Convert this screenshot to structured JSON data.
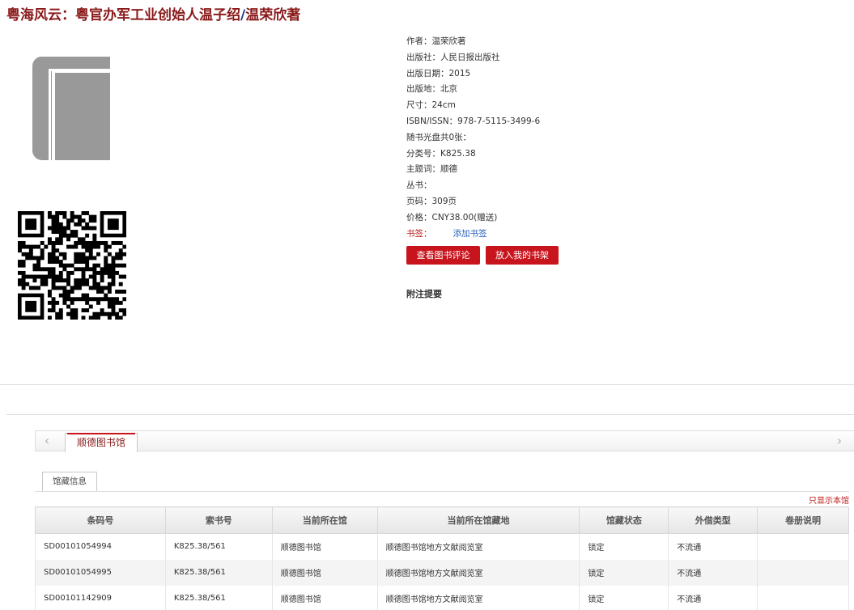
{
  "book": {
    "title_main": "粤海风云：粤官办军工业创始人温子绍",
    "title_sep": "/",
    "title_author": "温荣欣著"
  },
  "meta": [
    {
      "label": "作者：",
      "value": "温荣欣著"
    },
    {
      "label": "出版社：",
      "value": "人民日报出版社"
    },
    {
      "label": "出版日期：",
      "value": "2015"
    },
    {
      "label": "出版地：",
      "value": "北京"
    },
    {
      "label": "尺寸：",
      "value": "24cm"
    },
    {
      "label": "ISBN/ISSN：",
      "value": "978-7-5115-3499-6"
    },
    {
      "label": "随书光盘共0张：",
      "value": ""
    },
    {
      "label": "分类号：",
      "value": "K825.38"
    },
    {
      "label": "主题词：",
      "value": "顺德"
    },
    {
      "label": "丛书：",
      "value": ""
    },
    {
      "label": "页码：",
      "value": "309页"
    },
    {
      "label": "价格：",
      "value": "CNY38.00(赠送)"
    }
  ],
  "bookmark": {
    "label": "书签：",
    "link": "添加书签"
  },
  "buttons": {
    "review": "查看图书评论",
    "shelf": "放入我的书架"
  },
  "notes_label": "附注提要",
  "tabs": {
    "library": "顺德图书馆",
    "sub": "馆藏信息",
    "arrow_left": "‹",
    "arrow_right": "›"
  },
  "show_lib": "只显示本馆",
  "table": {
    "headers": [
      "条码号",
      "索书号",
      "当前所在馆",
      "当前所在馆藏地",
      "馆藏状态",
      "外借类型",
      "卷册说明"
    ],
    "rows": [
      [
        "SD00101054994",
        "K825.38/561",
        "顺德图书馆",
        "顺德图书馆地方文献阅览室",
        "锁定",
        "不流通",
        ""
      ],
      [
        "SD00101054995",
        "K825.38/561",
        "顺德图书馆",
        "顺德图书馆地方文献阅览室",
        "锁定",
        "不流通",
        ""
      ],
      [
        "SD00101142909",
        "K825.38/561",
        "顺德图书馆",
        "顺德图书馆地方文献阅览室",
        "锁定",
        "不流通",
        ""
      ]
    ]
  },
  "colors": {
    "accent": "#c8151d",
    "title": "#8a1a1a",
    "link": "#2a62c0"
  },
  "icons": {
    "cover": "book-cover-icon",
    "qr": "qr-code-icon"
  }
}
